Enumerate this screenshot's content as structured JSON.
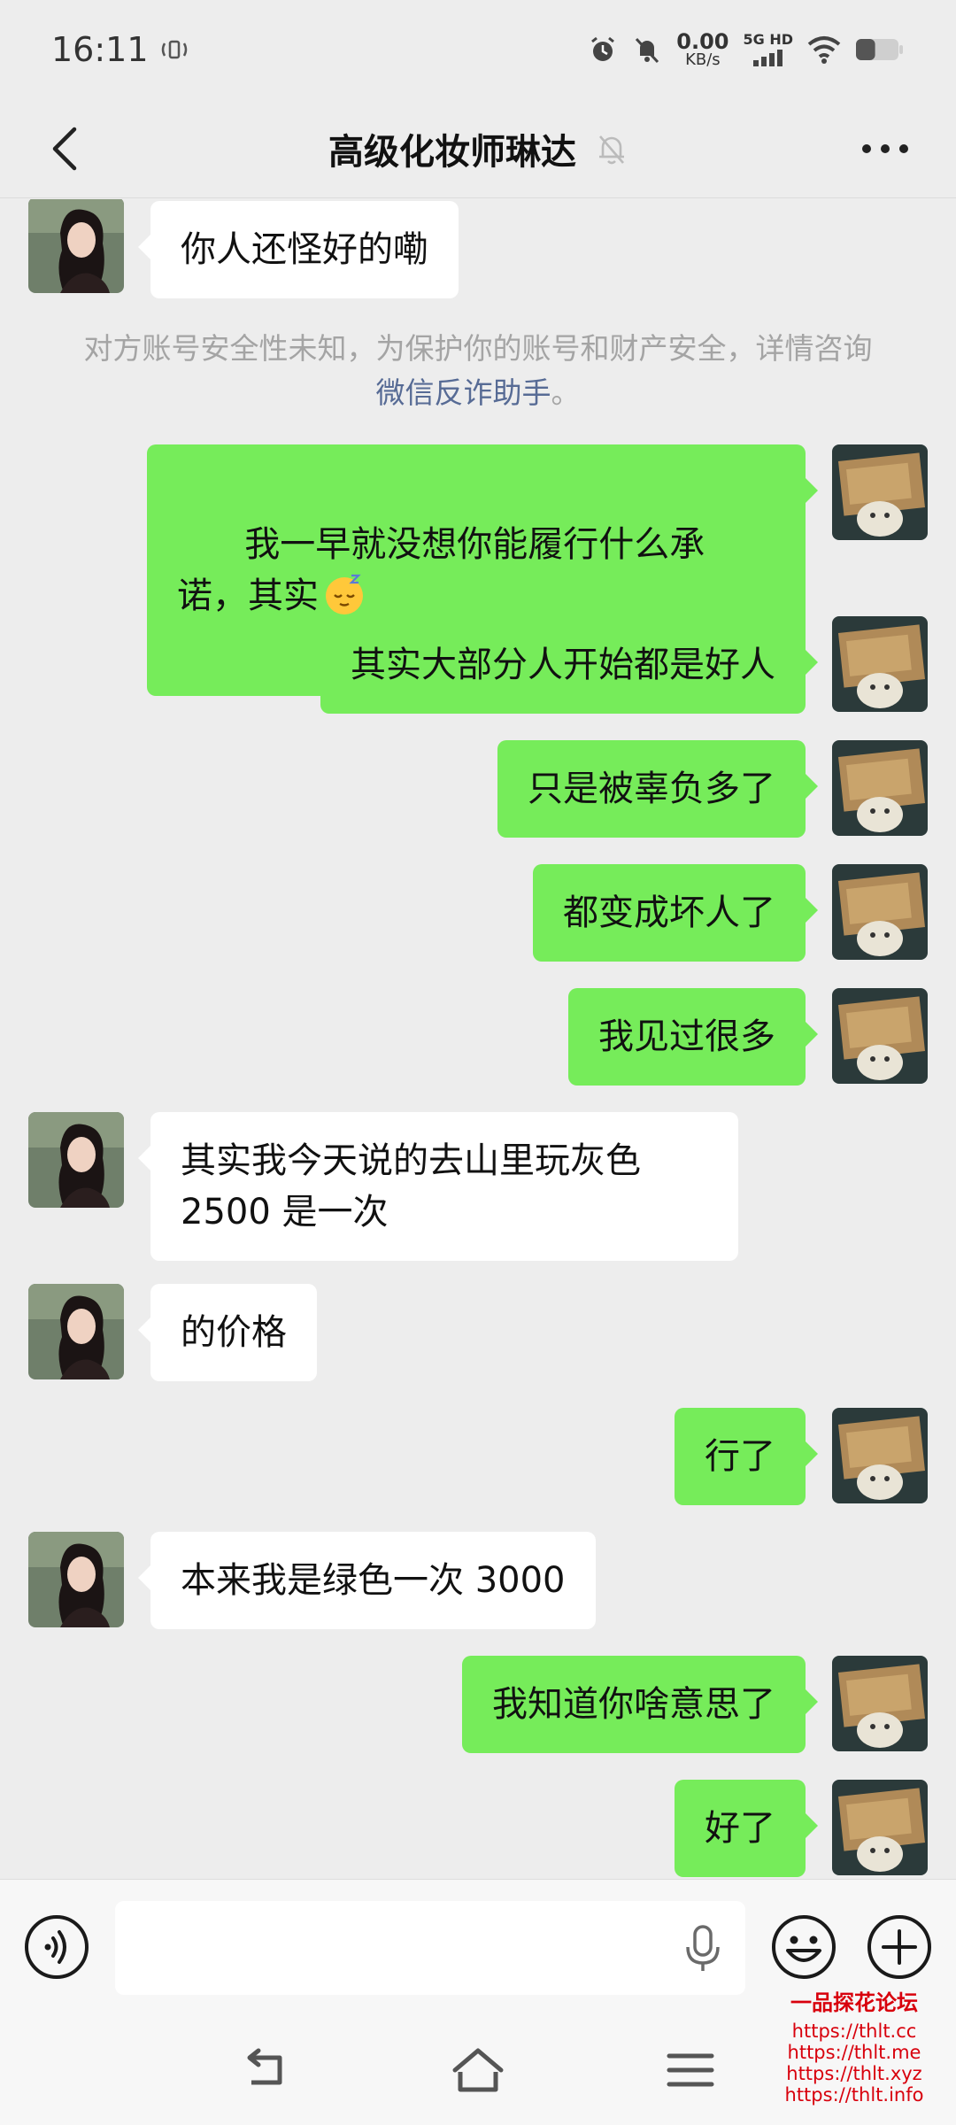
{
  "status_bar": {
    "time": "16:11",
    "net_speed_value": "0.00",
    "net_speed_unit": "KB/s",
    "signal_label": "5G HD",
    "battery_level": 0.45
  },
  "header": {
    "title": "高级化妆师琳达",
    "muted_icon": "bell-off-icon",
    "back_icon": "chevron-left-icon",
    "more_icon": "more-dots-icon"
  },
  "notice": {
    "text": "对方账号安全性未知，为保护你的账号和财产安全，详情咨询",
    "link": "微信反诈助手",
    "suffix": "。"
  },
  "messages": [
    {
      "from": "them",
      "text": "你人还怪好的嘞"
    },
    {
      "from": "me",
      "text": "我一早就没想你能履行什么承诺，其实"
    },
    {
      "from": "me",
      "text": "其实大部分人开始都是好人"
    },
    {
      "from": "me",
      "text": "只是被辜负多了"
    },
    {
      "from": "me",
      "text": "都变成坏人了"
    },
    {
      "from": "me",
      "text": "我见过很多"
    },
    {
      "from": "them",
      "text": "其实我今天说的去山里玩灰色\n2500 是一次"
    },
    {
      "from": "them",
      "text": "的价格"
    },
    {
      "from": "me",
      "text": "行了"
    },
    {
      "from": "them",
      "text": "本来我是绿色一次 3000"
    },
    {
      "from": "me",
      "text": "我知道你啥意思了"
    },
    {
      "from": "me",
      "text": "好了"
    }
  ],
  "input_bar": {
    "placeholder": "",
    "voice_icon": "voice-icon",
    "mic_icon": "mic-icon",
    "emoji_icon": "emoji-icon",
    "plus_icon": "plus-icon"
  },
  "watermark": {
    "title": "一品探花论坛",
    "lines": [
      "https://thlt.cc",
      "https://thlt.me",
      "https://thlt.xyz",
      "https://thlt.info"
    ]
  },
  "colors": {
    "background": "#ededed",
    "bubble_me": "#76ec5a",
    "bubble_them": "#ffffff",
    "link": "#576b95",
    "watermark": "#d8000c"
  }
}
